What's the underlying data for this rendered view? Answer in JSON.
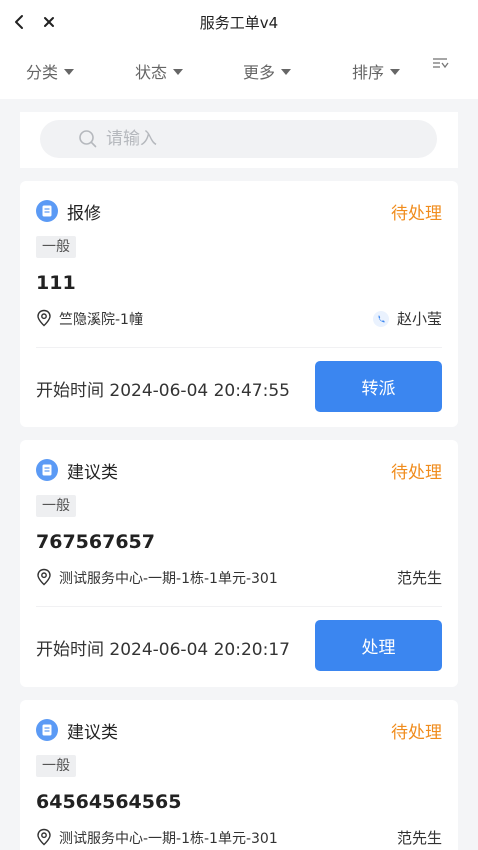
{
  "header": {
    "title": "服务工单v4"
  },
  "filters": [
    {
      "label": "分类"
    },
    {
      "label": "状态"
    },
    {
      "label": "更多"
    },
    {
      "label": "排序"
    }
  ],
  "search": {
    "placeholder": "请输入"
  },
  "cards": [
    {
      "category": "报修",
      "status": "待处理",
      "level": "一般",
      "order_no": "111",
      "address": "竺隐溪院-1幢",
      "person": "赵小莹",
      "start_time": "开始时间 2024-06-04 20:47:55",
      "action": "转派"
    },
    {
      "category": "建议类",
      "status": "待处理",
      "level": "一般",
      "order_no": "767567657",
      "address": "测试服务中心-一期-1栋-1单元-301",
      "person": "范先生",
      "start_time": "开始时间 2024-06-04 20:20:17",
      "action": "处理"
    },
    {
      "category": "建议类",
      "status": "待处理",
      "level": "一般",
      "order_no": "64564564565",
      "address": "测试服务中心-一期-1栋-1单元-301",
      "person": "范先生"
    }
  ],
  "colors": {
    "accent": "#3b86f0",
    "status_pending": "#f08c1d",
    "page_bg": "#f4f5f7"
  },
  "icons": {
    "back": "chevron-left-icon",
    "close": "close-icon",
    "filter_toggle": "filter-lines-icon",
    "search": "search-icon",
    "category": "document-icon",
    "location": "location-pin-icon",
    "phone": "phone-icon"
  }
}
